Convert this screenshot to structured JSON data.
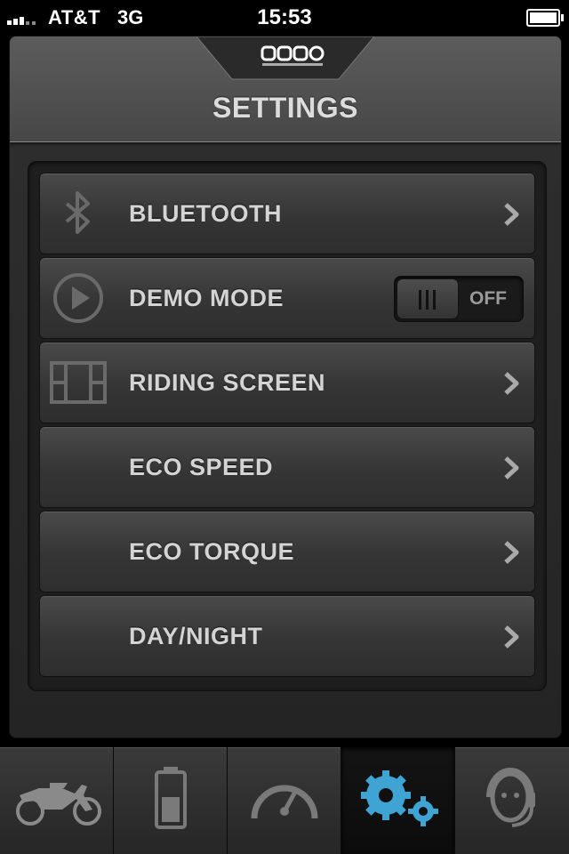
{
  "status_bar": {
    "carrier": "AT&T",
    "network": "3G",
    "time": "15:53",
    "signal_icon": "signal-bars-icon",
    "battery_icon": "battery-icon"
  },
  "header": {
    "logo_icon": "zero-motorcycles-logo",
    "title": "SETTINGS"
  },
  "settings_items": [
    {
      "label": "BLUETOOTH",
      "icon": "bluetooth-icon",
      "accessory": "chevron"
    },
    {
      "label": "DEMO MODE",
      "icon": "play-circle-icon",
      "accessory": "toggle",
      "toggle_label": "OFF"
    },
    {
      "label": "RIDING SCREEN",
      "icon": "screen-layout-icon",
      "accessory": "chevron"
    },
    {
      "label": "ECO SPEED",
      "accessory": "chevron"
    },
    {
      "label": "ECO TORQUE",
      "accessory": "chevron"
    },
    {
      "label": "DAY/NIGHT",
      "accessory": "chevron"
    }
  ],
  "tab_bar": {
    "tabs": [
      {
        "icon": "motorcycle-icon",
        "active": false
      },
      {
        "icon": "battery-status-icon",
        "active": false
      },
      {
        "icon": "speedometer-icon",
        "active": false
      },
      {
        "icon": "gears-icon",
        "active": true
      },
      {
        "icon": "support-headset-icon",
        "active": false
      }
    ]
  },
  "colors": {
    "accent": "#3fa4d4",
    "label_text": "#d4d4d4",
    "header_bg": "#555555"
  }
}
